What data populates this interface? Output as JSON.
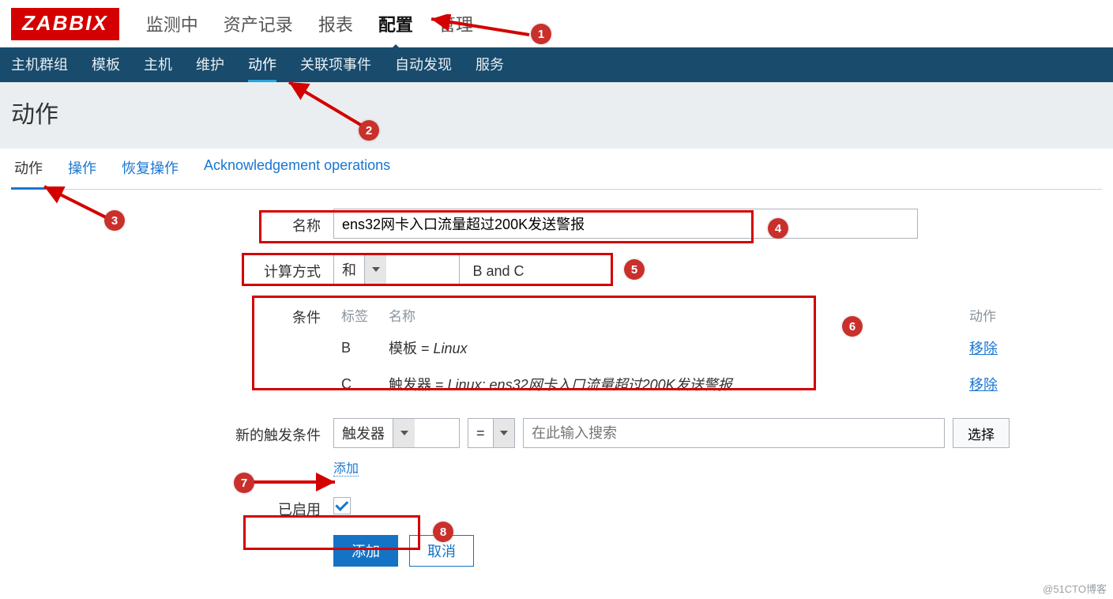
{
  "logo": "ZABBIX",
  "top_nav": {
    "items": [
      "监测中",
      "资产记录",
      "报表",
      "配置",
      "管理"
    ],
    "active_index": 3
  },
  "sub_nav": {
    "items": [
      "主机群组",
      "模板",
      "主机",
      "维护",
      "动作",
      "关联项事件",
      "自动发现",
      "服务"
    ],
    "active_index": 4
  },
  "page_title": "动作",
  "tabs": {
    "items": [
      "动作",
      "操作",
      "恢复操作",
      "Acknowledgement operations"
    ],
    "active_index": 0
  },
  "form": {
    "name": {
      "label": "名称",
      "value": "ens32网卡入口流量超过200K发送警报"
    },
    "calc": {
      "label": "计算方式",
      "select_value": "和",
      "expression": "B and C"
    },
    "conditions": {
      "label": "条件",
      "header_tag": "标签",
      "header_name": "名称",
      "header_action": "动作",
      "remove_text": "移除",
      "rows": [
        {
          "tag": "B",
          "prefix": "模板",
          "eq": " = ",
          "value": "Linux"
        },
        {
          "tag": "C",
          "prefix": "触发器",
          "eq": " = ",
          "value": "Linux: ens32网卡入口流量超过200K发送警报"
        }
      ]
    },
    "new_condition": {
      "label": "新的触发条件",
      "type": "触发器",
      "op": "=",
      "search_placeholder": "在此输入搜索",
      "select_btn": "选择",
      "add_link": "添加"
    },
    "enabled": {
      "label": "已启用",
      "checked": true
    },
    "buttons": {
      "submit": "添加",
      "cancel": "取消"
    }
  },
  "annotations": {
    "markers": [
      "1",
      "2",
      "3",
      "4",
      "5",
      "6",
      "7",
      "8"
    ]
  },
  "watermark": "@51CTO博客"
}
